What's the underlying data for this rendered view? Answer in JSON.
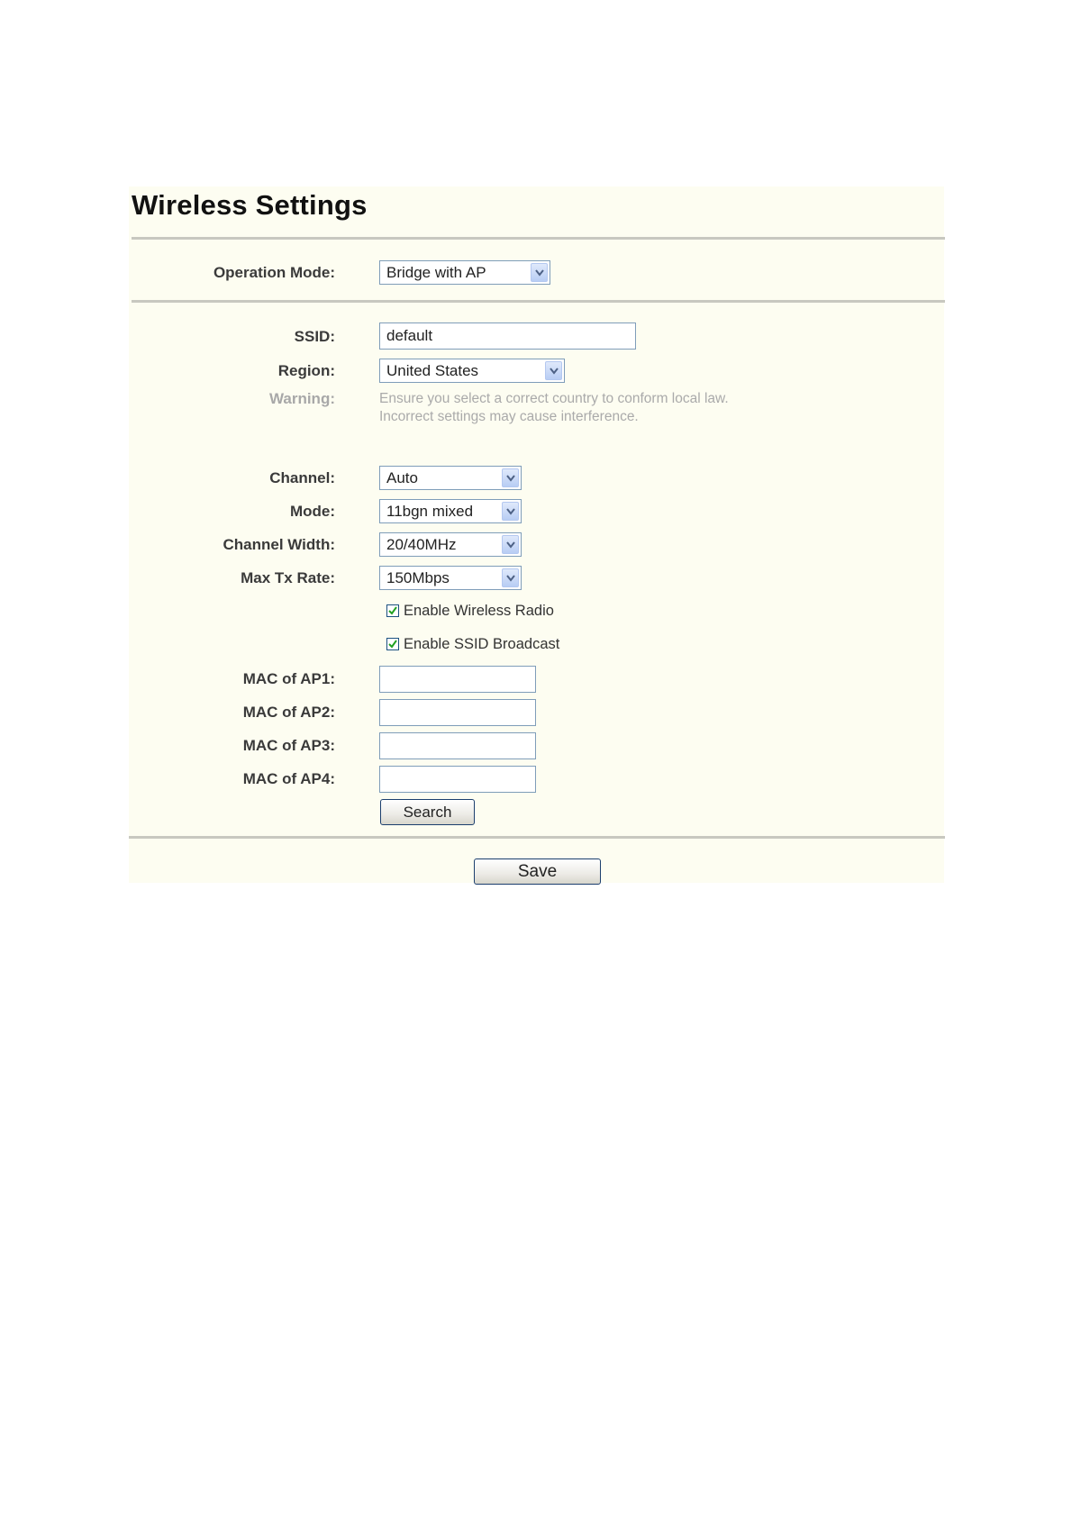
{
  "page": {
    "title": "Wireless Settings"
  },
  "operation_mode": {
    "label": "Operation Mode:",
    "value": "Bridge with AP"
  },
  "ssid": {
    "label": "SSID:",
    "value": "default"
  },
  "region": {
    "label": "Region:",
    "value": "United States"
  },
  "warning": {
    "label": "Warning:",
    "line1": "Ensure you select a correct country to conform local law.",
    "line2": "Incorrect settings may cause interference."
  },
  "channel": {
    "label": "Channel:",
    "value": "Auto"
  },
  "mode": {
    "label": "Mode:",
    "value": "11bgn mixed"
  },
  "channel_width": {
    "label": "Channel Width:",
    "value": "20/40MHz"
  },
  "max_tx_rate": {
    "label": "Max Tx Rate:",
    "value": "150Mbps"
  },
  "checkboxes": {
    "wireless_radio": {
      "label": "Enable Wireless Radio",
      "checked": true
    },
    "ssid_broadcast": {
      "label": "Enable SSID Broadcast",
      "checked": true
    }
  },
  "mac_fields": [
    {
      "label": "MAC of AP1:",
      "value": ""
    },
    {
      "label": "MAC of AP2:",
      "value": ""
    },
    {
      "label": "MAC of AP3:",
      "value": ""
    },
    {
      "label": "MAC of AP4:",
      "value": ""
    }
  ],
  "buttons": {
    "search": "Search",
    "save": "Save"
  },
  "icons": {
    "dropdown": "chevron-down-icon",
    "checkmark": "checkmark-icon"
  },
  "colors": {
    "panel_background": "#fdfdf1",
    "divider": "#c8c8c0",
    "input_border": "#7f9db9",
    "warning_text": "#aaaaaa"
  }
}
